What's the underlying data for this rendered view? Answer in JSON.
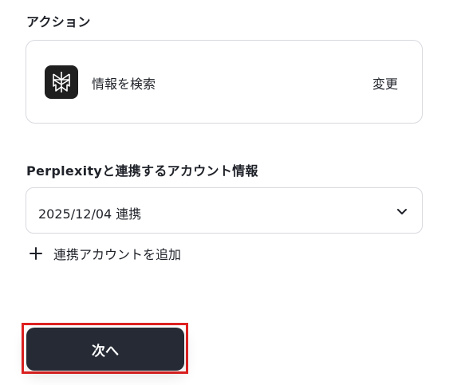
{
  "action_section": {
    "label": "アクション",
    "action_name": "情報を検索",
    "change_label": "変更",
    "app_icon": "perplexity-logo-icon"
  },
  "account_section": {
    "label": "Perplexityと連携するアカウント情報",
    "selected_account": "2025/12/04 連携",
    "dropdown_icon": "chevron-down-icon",
    "add_account_label": "連携アカウントを追加",
    "add_icon": "plus-icon"
  },
  "footer": {
    "next_label": "次へ"
  },
  "colors": {
    "text": "#1f2229",
    "border": "#d7d9de",
    "button_bg": "#252a34",
    "highlight": "#e02121",
    "logo_bg": "#1f1f1f"
  }
}
